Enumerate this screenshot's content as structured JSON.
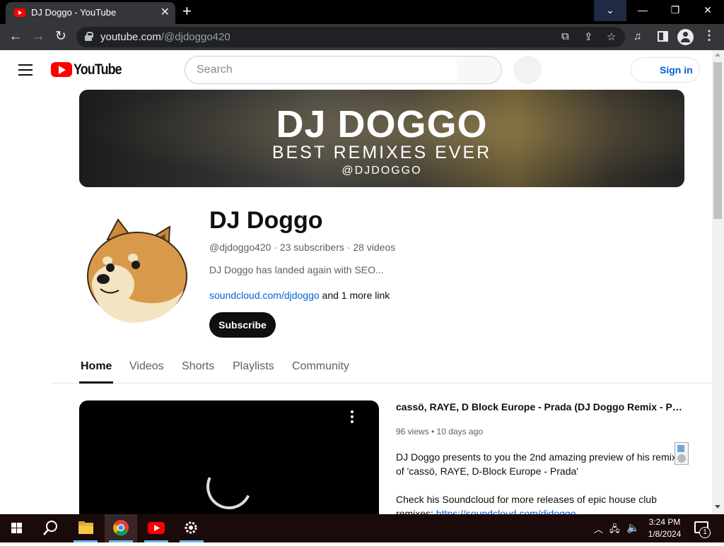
{
  "browser": {
    "tab_title": "DJ Doggo - YouTube",
    "url_host": "youtube.com",
    "url_path": "/@djdoggo420",
    "new_tab_glyph": "+",
    "tab_close_glyph": "✕"
  },
  "header": {
    "logo_text": "YouTube",
    "search_placeholder": "Search",
    "signin_label": "Sign in"
  },
  "banner": {
    "title": "DJ DOGGO",
    "subtitle": "BEST REMIXES EVER",
    "handle": "@DJDOGGO"
  },
  "channel": {
    "name": "DJ Doggo",
    "meta": "@djdoggo420 · 23 subscribers · 28 videos",
    "description": "DJ Doggo has landed again with SEO...",
    "link": "soundcloud.com/djdoggo",
    "more_links": " and 1 more link",
    "subscribe_label": "Subscribe"
  },
  "tabs": [
    "Home",
    "Videos",
    "Shorts",
    "Playlists",
    "Community"
  ],
  "featured_video": {
    "title": "cassö, RAYE, D Block Europe - Prada (DJ Doggo Remix - Previe...",
    "meta": "96 views • 10 days ago",
    "description_1": "DJ Doggo presents to you the 2nd amazing preview of his remix of 'cassö, RAYE, D-Block Europe - Prada'",
    "description_2_prefix": "Check his Soundcloud for more releases of epic house club remixes: ",
    "description_2_link": "https://soundcloud.com/djdoggo"
  },
  "taskbar": {
    "time": "3:24 PM",
    "date": "1/8/2024",
    "notification_count": "1"
  },
  "colors": {
    "youtube_red": "#ff0000",
    "link_blue": "#065fd4",
    "chrome_dark": "#35363a",
    "taskbar": "#1a0a0a"
  }
}
